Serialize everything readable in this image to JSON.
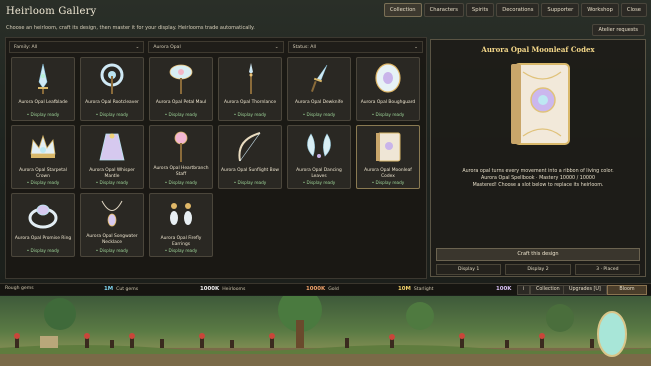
{
  "app": {
    "title": "Heirloom Gallery"
  },
  "tabs": [
    {
      "label": "Collection",
      "active": true
    },
    {
      "label": "Characters"
    },
    {
      "label": "Spirits"
    },
    {
      "label": "Decorations"
    },
    {
      "label": "Supporter"
    },
    {
      "label": "Workshop"
    },
    {
      "label": "Close"
    }
  ],
  "subtitle": "Choose an heirloom, craft its design, then master it for your display. Heirlooms trade automatically.",
  "atelier_button": "Atelier requests",
  "filters": [
    {
      "label": "Family: All",
      "icon": "chevron-down"
    },
    {
      "label": "Aurora Opal",
      "icon": "chevron-down"
    },
    {
      "label": "Status: All",
      "icon": "chevron-down"
    }
  ],
  "items": [
    {
      "name": "Aurora Opal Leafblade",
      "status": "• Display ready",
      "icon": "leaf-blade"
    },
    {
      "name": "Aurora Opal Rootcleaver",
      "status": "• Display ready",
      "icon": "axe"
    },
    {
      "name": "Aurora Opal Petal Maul",
      "status": "• Display ready",
      "icon": "maul"
    },
    {
      "name": "Aurora Opal Thornlance",
      "status": "• Display ready",
      "icon": "lance"
    },
    {
      "name": "Aurora Opal Dewknife",
      "status": "• Display ready",
      "icon": "knife"
    },
    {
      "name": "Aurora Opal Boughguard",
      "status": "• Display ready",
      "icon": "shield"
    },
    {
      "name": "Aurora Opal Starpetal Crown",
      "status": "• Display ready",
      "icon": "crown"
    },
    {
      "name": "Aurora Opal Whisper Mantle",
      "status": "• Display ready",
      "icon": "mantle"
    },
    {
      "name": "Aurora Opal Heartbranch Staff",
      "status": "• Display ready",
      "icon": "staff"
    },
    {
      "name": "Aurora Opal Sunflight Bow",
      "status": "• Display ready",
      "icon": "bow"
    },
    {
      "name": "Aurora Opal Dancing Leaves",
      "status": "• Display ready",
      "icon": "leaves"
    },
    {
      "name": "Aurora Opal Moonleaf Codex",
      "status": "• Display ready",
      "icon": "book",
      "selected": true
    },
    {
      "name": "Aurora Opal Promise Ring",
      "status": "• Display ready",
      "icon": "ring"
    },
    {
      "name": "Aurora Opal Songwater Necklace",
      "status": "• Display ready",
      "icon": "necklace"
    },
    {
      "name": "Aurora Opal Firefly Earrings",
      "status": "• Display ready",
      "icon": "earrings"
    }
  ],
  "detail": {
    "title": "Aurora Opal Moonleaf Codex",
    "description": "Aurora opal turns every movement into a ribbon of living color.",
    "stats": "Aurora Opal Spellbook · Mastery 10000 / 10000",
    "note": "Mastered! Choose a slot below to replace its heirloom.",
    "craft_label": "Craft this design",
    "slots": [
      "Display 1",
      "Display 2",
      "3 · Placed"
    ]
  },
  "resources": [
    {
      "label": "Rough gems",
      "value": "1M",
      "color": "#7fd4f0"
    },
    {
      "label": "Cut gems",
      "value": "1000K",
      "color": "#f0f0f0"
    },
    {
      "label": "Heirlooms",
      "value": "1000K",
      "color": "#f2a36b"
    },
    {
      "label": "Gold",
      "value": "10M",
      "color": "#f3d26a"
    },
    {
      "label": "Starlight",
      "value": "100K",
      "color": "#d8c0f5"
    }
  ],
  "bottom_buttons": {
    "info": "i",
    "collection": "Collection",
    "upgrades": "Upgrades [U]",
    "bloom": "Bloom"
  },
  "colors": {
    "accent": "#f6d98a",
    "ready": "#9fd79a",
    "panel": "#2a2823"
  }
}
